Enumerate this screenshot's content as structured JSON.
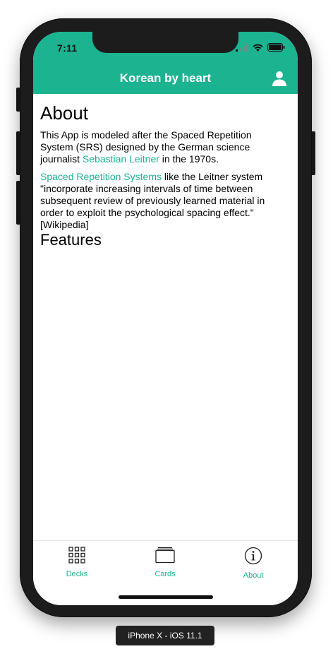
{
  "status_bar": {
    "time": "7:11"
  },
  "nav": {
    "title": "Korean by heart",
    "profile_icon": "person-icon"
  },
  "about": {
    "heading": "About",
    "para1_before": "This App is modeled after the Spaced Repetition System (SRS) designed by the German science journalist ",
    "para1_link": "Sebastian Leitner",
    "para1_after": " in the 1970s.",
    "para2_link": "Spaced Repetition Systems",
    "para2_text": " like the Leitner system \"incorporate increasing intervals of time between subsequent review of previously learned material in order to exploit the psychological spacing effect.\" [Wikipedia]",
    "features_heading": "Features"
  },
  "tabs": [
    {
      "label": "Decks",
      "icon": "grid-icon"
    },
    {
      "label": "Cards",
      "icon": "cards-icon"
    },
    {
      "label": "About",
      "icon": "info-icon"
    }
  ],
  "device_label": "iPhone X - iOS 11.1",
  "colors": {
    "accent": "#1cb391",
    "frame": "#1c1c1c"
  }
}
